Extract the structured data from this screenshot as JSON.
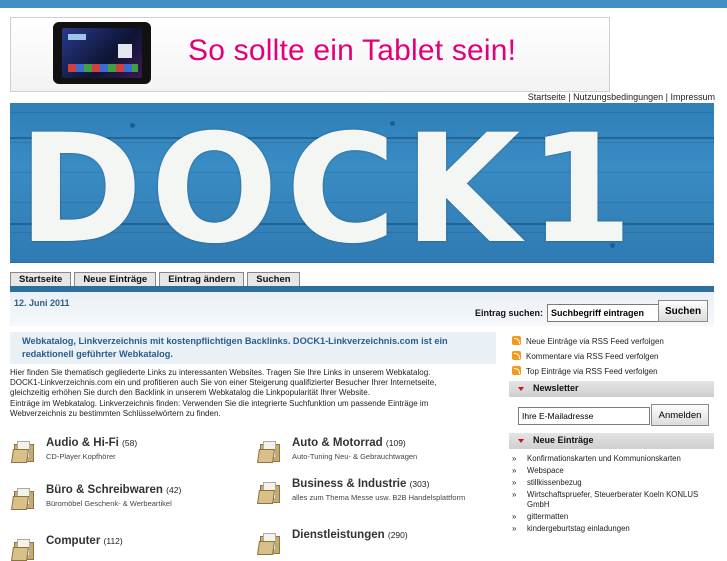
{
  "ad": {
    "slogan": "So sollte ein Tablet sein!"
  },
  "top_links": [
    "Startseite",
    "Nutzungsbedingungen",
    "Impressum"
  ],
  "top_links_sep": " | ",
  "banner": {
    "text": "DOCK1"
  },
  "tabs": [
    "Startseite",
    "Neue Einträge",
    "Eintrag ändern",
    "Suchen"
  ],
  "date": "12. Juni 2011",
  "search": {
    "label": "Eintrag suchen:",
    "value": "Suchbegriff eintragen",
    "button": "Suchen"
  },
  "intro": {
    "headline": "Webkatalog, Linkverzeichnis mit kostenpflichtigen Backlinks. DOCK1-Linkverzeichnis.com ist ein redaktionell geführter Webkatalog.",
    "lines": [
      "Hier finden Sie thematisch gegliederte Links zu interessanten Websites. Tragen Sie Ihre Links in unserem Webkatalog.",
      "DOCK1-Linkverzeichnis.com ein und profitieren auch Sie von einer Steigerung qualifizierter Besucher Ihrer Internetseite,",
      "gleichzeitig erhöhen Sie durch den Backlink in unserem Webkatalog die Linkpopularität Ihrer Website.",
      "Einträge im Webkatalog. Linkverzeichnis finden: Verwenden Sie die integrierte Suchfunktion um passende Einträge im",
      "Webverzeichnis zu bestimmten Schlüsselwörtern zu finden."
    ]
  },
  "categories": [
    {
      "title": "Audio & Hi-Fi",
      "count": "(58)",
      "sub": "CD-Player Kopfhörer"
    },
    {
      "title": "Auto & Motorrad",
      "count": "(109)",
      "sub": "Auto-Tuning  Neu- & Gebrauchtwagen"
    },
    {
      "title": "Büro & Schreibwaren",
      "count": "(42)",
      "sub": "Büromöbel Geschenk- & Werbeartikel"
    },
    {
      "title": "Business & Industrie",
      "count": "(303)",
      "sub": "alles zum Thema Messe usw. B2B Handelsplattform"
    },
    {
      "title": "Computer",
      "count": "(112)",
      "sub": ""
    },
    {
      "title": "Dienstleistungen",
      "count": "(290)",
      "sub": ""
    }
  ],
  "rss_links": [
    "Neue Einträge via RSS Feed verfolgen",
    "Kommentare via RSS Feed verfolgen",
    "Top Einträge via RSS Feed verfolgen"
  ],
  "newsletter": {
    "title": "Newsletter",
    "placeholder": "Ihre E-Mailadresse",
    "button": "Anmelden"
  },
  "new_entries": {
    "title": "Neue Einträge",
    "items": [
      "Konfirmationskarten und Kommunionskarten",
      "Webspace",
      "stillkissenbezug",
      "Wirtschaftspruefer, Steuerberater Koeln KONLUS GmbH",
      "gittermatten",
      "kindergeburtstag einladungen"
    ]
  },
  "colors": {
    "accent": "#2c6e9e",
    "topbar": "#3f8fc0",
    "ad_magenta": "#e2007a",
    "intro_text": "#2b5c8a",
    "rss": "#f39a1d",
    "arrow": "#c8141e"
  }
}
